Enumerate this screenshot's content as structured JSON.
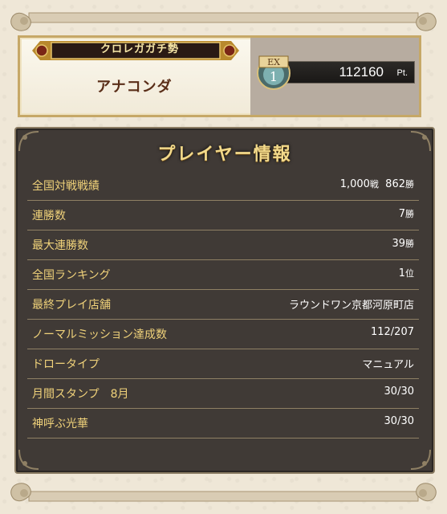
{
  "header": {
    "guild_name": "クロレガガチ勢",
    "player_name": "アナコンダ",
    "rank_badge": "EX 1",
    "points_value": "112160",
    "points_unit": "Pt."
  },
  "info_panel": {
    "title": "プレイヤー情報",
    "rows": [
      {
        "label": "全国対戦戦績",
        "value": "1,000",
        "unit": "戦",
        "value2": "862",
        "unit2": "勝"
      },
      {
        "label": "連勝数",
        "value": "7",
        "unit": "勝"
      },
      {
        "label": "最大連勝数",
        "value": "39",
        "unit": "勝"
      },
      {
        "label": "全国ランキング",
        "value": "1",
        "unit": "位"
      },
      {
        "label": "最終プレイ店舗",
        "value": "ラウンドワン京都河原町店",
        "unit": ""
      },
      {
        "label": "ノーマルミッション達成数",
        "value": "112/207",
        "unit": ""
      },
      {
        "label": "ドロータイプ",
        "value": "マニュアル",
        "unit": ""
      },
      {
        "label": "月間スタンプ　8月",
        "value": "30/30",
        "unit": ""
      },
      {
        "label": "神呼ぶ光華",
        "value": "30/30",
        "unit": ""
      }
    ]
  },
  "colors": {
    "accent_gold": "#f0d27a",
    "panel_bg": "#403a36",
    "page_bg": "#efe7d7"
  }
}
